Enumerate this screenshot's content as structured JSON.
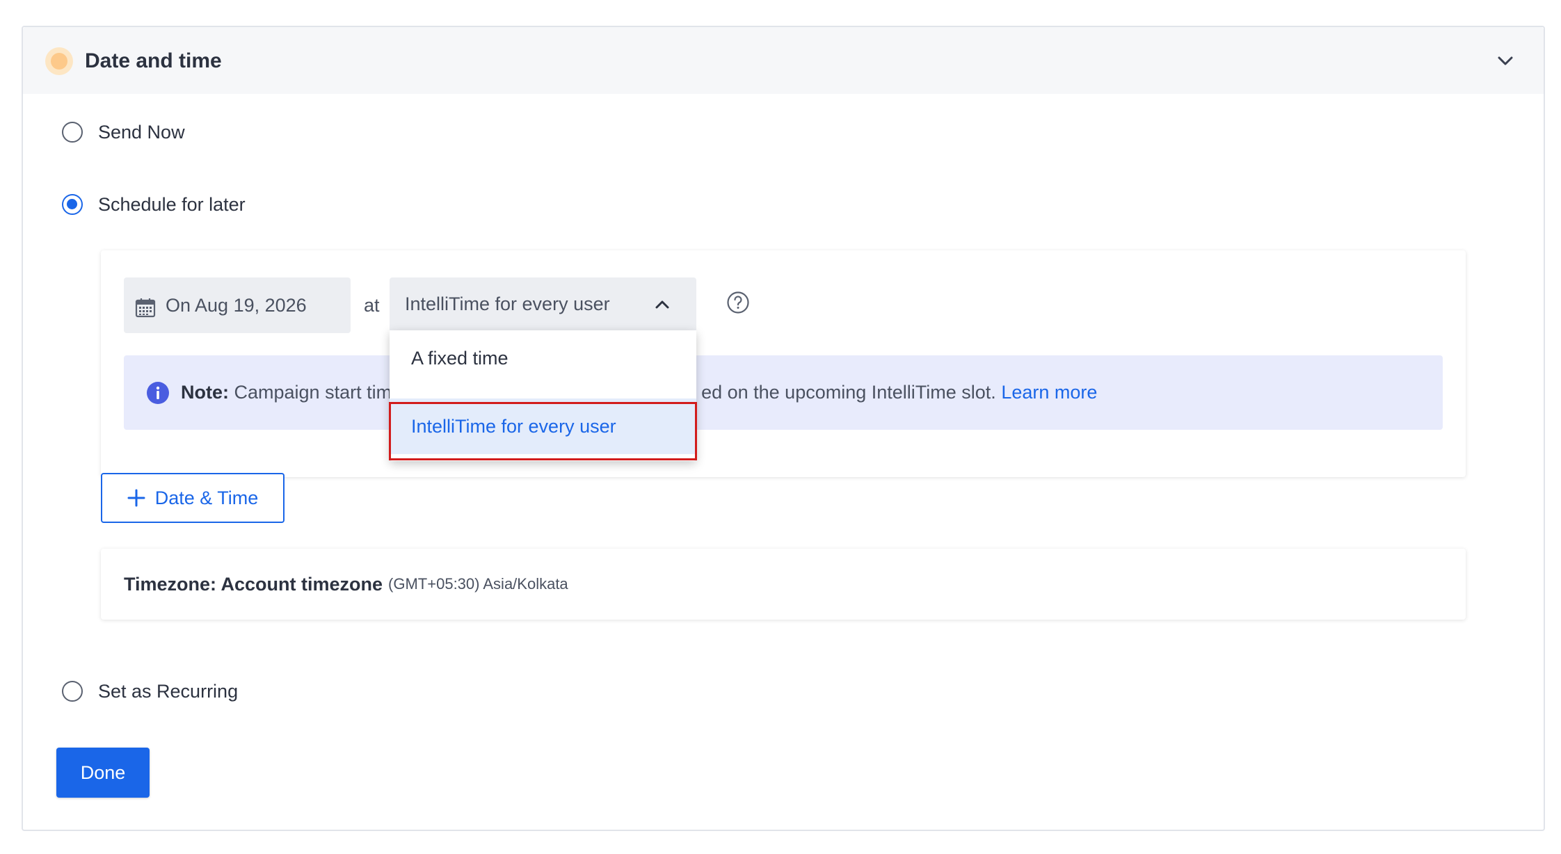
{
  "section": {
    "title": "Date and time",
    "status_icon": "status-dot-icon",
    "collapse_icon": "chevron-down-icon"
  },
  "options": {
    "send_now": "Send Now",
    "schedule_later": "Schedule for later",
    "recurring": "Set as Recurring",
    "selected": "Schedule for later"
  },
  "schedule": {
    "date_value": "On Aug 19, 2026",
    "at_label": "at",
    "time_mode_value": "IntelliTime for every user",
    "dropdown_options": [
      "A fixed time",
      "IntelliTime for every user"
    ],
    "selected_option": "IntelliTime for every user",
    "note_label": "Note:",
    "note_text_left": " Campaign start tim",
    "note_text_right": "ed on the upcoming IntelliTime slot. ",
    "learn_more": "Learn more"
  },
  "add_button_label": "Date & Time",
  "timezone": {
    "label": "Timezone: Account timezone",
    "value": "(GMT+05:30) Asia/Kolkata"
  },
  "done_label": "Done",
  "colors": {
    "accent": "#1a66e8",
    "note_bg": "#e8ebfc",
    "highlight": "#d21c1c",
    "status": "#fdc98a"
  }
}
